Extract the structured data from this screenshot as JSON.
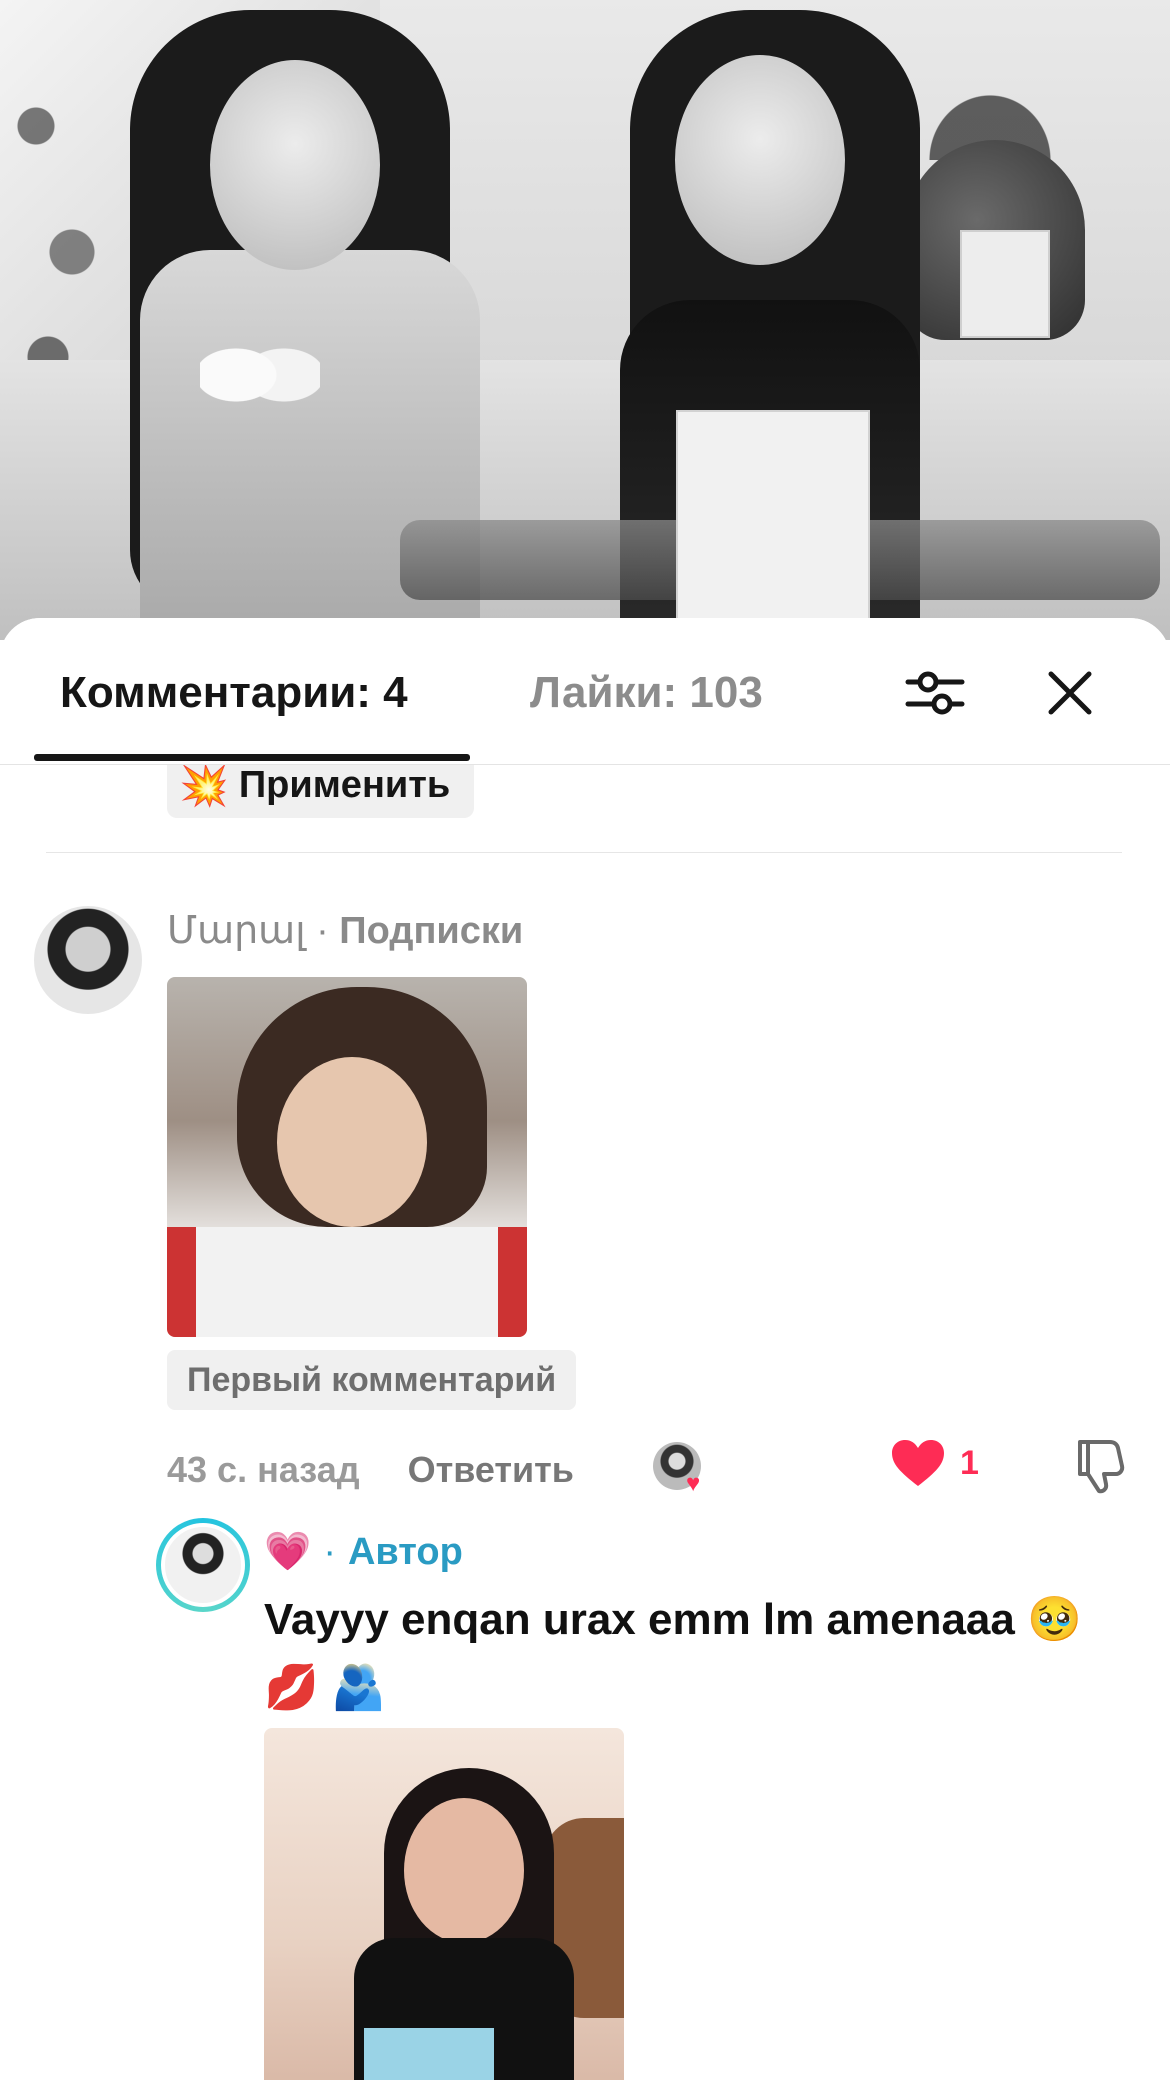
{
  "tabs": {
    "comments_label": "Комментарии: 4",
    "likes_label": "Лайки: 103"
  },
  "apply_chip": {
    "emoji": "💥",
    "label": "Применить"
  },
  "comment1": {
    "username": "Մարալ",
    "separator": " · ",
    "relation": "Подписки",
    "badge": "Первый комментарий",
    "time": "43 с. назад",
    "reply_label": "Ответить",
    "like_count": "1"
  },
  "comment2": {
    "username_emoji": "💗",
    "separator": "·",
    "role": "Автор",
    "text": "Vayyy enqan urax emm lm amenaaa 🥹 💋 🫂"
  },
  "icons": {
    "filter": "sliders-icon",
    "close": "close-icon",
    "heart": "heart-icon",
    "dislike": "thumbs-down-icon"
  },
  "colors": {
    "like_red": "#fe2c55",
    "author_blue": "#2a9bc3",
    "text_dark": "#161616",
    "muted": "#8c8c8c"
  }
}
